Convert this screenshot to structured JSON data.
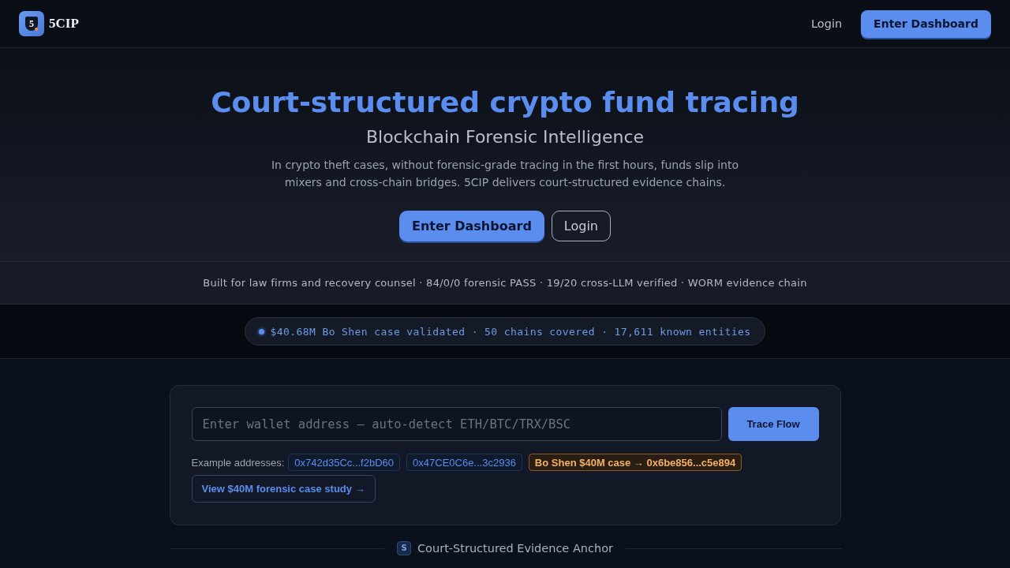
{
  "header": {
    "logo_mark": "5",
    "brand": "5CIP",
    "nav": [
      {
        "label": "Login",
        "kind": "link"
      },
      {
        "label": "Enter Dashboard",
        "kind": "primary"
      }
    ]
  },
  "hero": {
    "title": "Court-structured crypto fund tracing",
    "subtitle": "Blockchain Forensic Intelligence",
    "description": "In crypto theft cases, without forensic-grade tracing in the first hours, funds slip into mixers and cross-chain bridges. 5CIP delivers court-structured evidence chains.",
    "actions": [
      {
        "label": "Enter Dashboard",
        "kind": "primary"
      },
      {
        "label": "Login",
        "kind": "outline"
      }
    ]
  },
  "trust_bar": {
    "text": "Built for law firms and recovery counsel · 84/0/0 forensic PASS · 19/20 cross-LLM verified · WORM evidence chain"
  },
  "stats_pill": {
    "text": "$40.68M Bo Shen case validated · 50 chains covered · 17,611 known entities"
  },
  "trace": {
    "input": {
      "placeholder": "Enter wallet address — auto-detect ETH/BTC/TRX/BSC"
    },
    "button": "Trace Flow",
    "examples_label": "Example addresses:",
    "examples": [
      {
        "label": "0x742d35Cc...f2bD60",
        "kind": "address"
      },
      {
        "label": "0x47CE0C6e...3c2936",
        "kind": "address"
      },
      {
        "label": "Bo Shen $40M case → 0x6be856...c5e894",
        "kind": "featured"
      }
    ],
    "case_link": "View $40M forensic case study →"
  },
  "section": {
    "badge": "S",
    "title": "Court-Structured Evidence Anchor"
  }
}
